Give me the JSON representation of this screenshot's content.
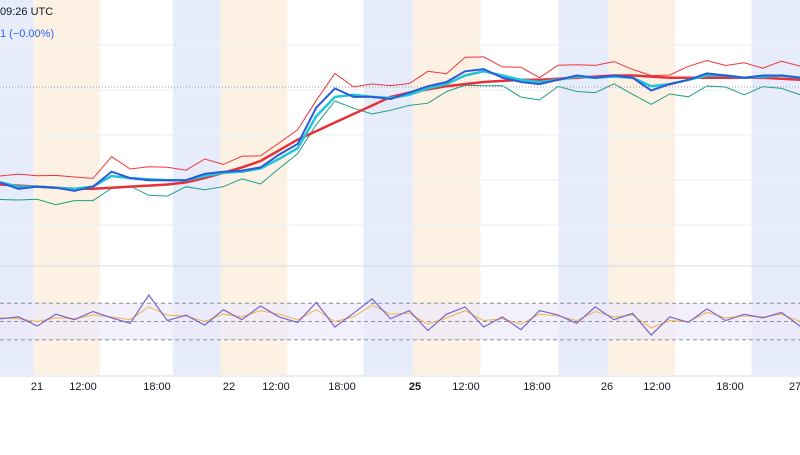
{
  "header": {
    "time": "09:26 UTC",
    "change": "1 (−0.00%)"
  },
  "colors": {
    "price": "#2a5bd7",
    "ema_fast": "#22c5d8",
    "ema_slow": "#e5323a",
    "band_upper": "#f0353b",
    "band_lower": "#1f9e8a",
    "osc": "#7b63c9",
    "osc_signal": "#f2b544",
    "session_blue": "#e7ecfb",
    "session_orange": "#fdf1e4",
    "osc_band": "#ece9fb",
    "grid": "#eceef2"
  },
  "chart_data": [
    {
      "type": "line",
      "x_ticks": [
        "21",
        "12:00",
        "18:00",
        "22",
        "12:00",
        "18:00",
        "25",
        "12:00",
        "18:00",
        "26",
        "12:00",
        "18:00",
        "27"
      ],
      "x": [
        0,
        4,
        8,
        12,
        16,
        20,
        24,
        28,
        32,
        36,
        40,
        44,
        48,
        52,
        56,
        60,
        64,
        68,
        72,
        76,
        80,
        84,
        88,
        92,
        96,
        100,
        104,
        108,
        112
      ],
      "series": [
        {
          "values": [
            34,
            31,
            32,
            31.5,
            30,
            32,
            39,
            36,
            35,
            35,
            35,
            38,
            39,
            39.5,
            41,
            47,
            52,
            69,
            78,
            74,
            74,
            73,
            76,
            79,
            81,
            86,
            87,
            83,
            81,
            80,
            82,
            84,
            83,
            84,
            83,
            77,
            80,
            82,
            85,
            84,
            83,
            84,
            84,
            83
          ]
        },
        {
          "values": [
            34,
            32,
            32,
            31.5,
            31,
            32,
            37,
            36,
            35.5,
            35,
            35,
            37,
            38.5,
            39,
            40.5,
            45,
            50,
            65,
            74,
            75,
            74,
            73.5,
            75,
            78,
            80,
            84,
            86,
            84,
            82,
            81,
            82,
            83.5,
            83,
            83.5,
            83,
            79,
            80,
            82,
            84,
            84,
            83,
            83.5,
            84,
            83
          ]
        },
        {
          "values": [
            33,
            32.5,
            32,
            31.5,
            31,
            31,
            31.5,
            32,
            32.5,
            33,
            34,
            36,
            38.5,
            41,
            44,
            49,
            54,
            58,
            62,
            66,
            70,
            74,
            76,
            77.5,
            79,
            80,
            81,
            81.5,
            82,
            82,
            82.5,
            83,
            83.5,
            84,
            84,
            83.5,
            83,
            83,
            83,
            83,
            83,
            83,
            82.5,
            82
          ]
        }
      ]
    },
    {
      "type": "line",
      "x": [
        0,
        4,
        8,
        12,
        16,
        20,
        24,
        28,
        32,
        36,
        40,
        44,
        48,
        52,
        56,
        60,
        64,
        68,
        72,
        76,
        80,
        84,
        88,
        92,
        96,
        100,
        104,
        108,
        112
      ],
      "series": [
        {
          "values": [
            53,
            55,
            45,
            58,
            52,
            61,
            54,
            48,
            79,
            51,
            57,
            46,
            63,
            52,
            67,
            55,
            49,
            71,
            44,
            59,
            75,
            53,
            62,
            40,
            58,
            66,
            44,
            55,
            41,
            62,
            57,
            48,
            66,
            52,
            59,
            35,
            55,
            49,
            64,
            51,
            58,
            54,
            60,
            45
          ]
        },
        {
          "values": [
            54,
            53,
            50,
            54,
            53,
            57,
            55,
            52,
            66,
            57,
            56,
            50,
            58,
            55,
            62,
            58,
            52,
            63,
            50,
            55,
            68,
            58,
            59,
            47,
            54,
            62,
            51,
            53,
            47,
            58,
            56,
            51,
            61,
            55,
            57,
            43,
            51,
            50,
            60,
            54,
            56,
            55,
            58,
            50
          ]
        }
      ],
      "levels": [
        70,
        50,
        30
      ]
    }
  ]
}
